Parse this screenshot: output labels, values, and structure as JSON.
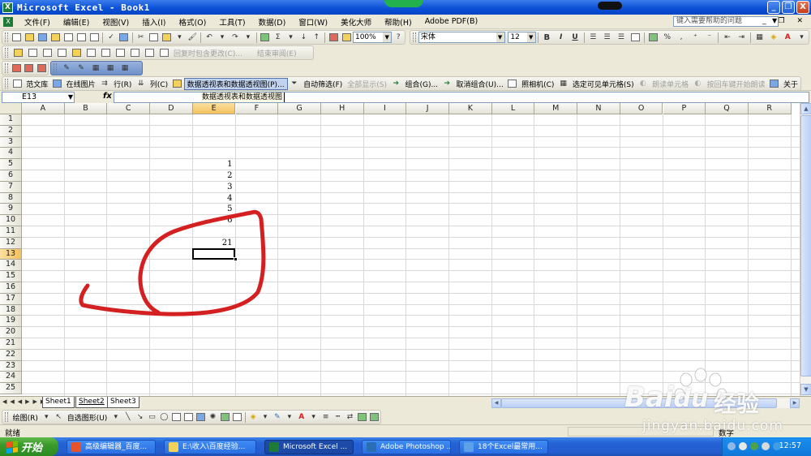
{
  "window": {
    "title": "Microsoft Excel - Book1",
    "minimize": "_",
    "restore": "❐",
    "close": "X"
  },
  "menu": {
    "items": [
      "文件(F)",
      "编辑(E)",
      "视图(V)",
      "插入(I)",
      "格式(O)",
      "工具(T)",
      "数据(D)",
      "窗口(W)",
      "美化大师",
      "帮助(H)",
      "Adobe PDF(B)"
    ],
    "help_placeholder": "键入需要帮助的问题"
  },
  "standard_toolbar": {
    "zoom": "100%"
  },
  "formatting_toolbar": {
    "font": "宋体",
    "size": "12",
    "bold": "B",
    "italic": "I",
    "underline": "U",
    "percent": "%",
    "comma": ","
  },
  "review_toolbar": {
    "reply_label": "回复时包含更改(C)...",
    "end_review": "结束审阅(E)"
  },
  "custom_toolbar": {
    "items": [
      "范文库",
      "在线图片",
      "行(R)",
      "列(C)",
      "数据透视表和数据透视图(P)...",
      "自动筛选(F)",
      "全部显示(S)",
      "组合(G)...",
      "取消组合(U)...",
      "照相机(C)",
      "选定可见单元格(S)",
      "朗读单元格",
      "按回车键开始朗读",
      "关于"
    ]
  },
  "formula_bar": {
    "name_box": "E13",
    "fx": "fx",
    "hint": "数据透视表和数据透视图"
  },
  "sheet": {
    "columns": [
      "A",
      "B",
      "C",
      "D",
      "E",
      "F",
      "G",
      "H",
      "I",
      "J",
      "K",
      "L",
      "M",
      "N",
      "O",
      "P",
      "Q",
      "R"
    ],
    "rows": [
      "1",
      "2",
      "3",
      "4",
      "5",
      "6",
      "7",
      "8",
      "9",
      "10",
      "11",
      "12",
      "13",
      "14",
      "15",
      "16",
      "17",
      "18",
      "19",
      "20",
      "21",
      "22",
      "23",
      "24",
      "25"
    ],
    "active_column": "E",
    "active_row": "13",
    "cells": [
      {
        "ref": "E5",
        "value": "1"
      },
      {
        "ref": "E6",
        "value": "2"
      },
      {
        "ref": "E7",
        "value": "3"
      },
      {
        "ref": "E8",
        "value": "4"
      },
      {
        "ref": "E9",
        "value": "5"
      },
      {
        "ref": "E10",
        "value": "6"
      },
      {
        "ref": "E12",
        "value": "21"
      }
    ]
  },
  "sheet_tabs": [
    "Sheet1",
    "Sheet2",
    "Sheet3"
  ],
  "active_sheet": "Sheet2",
  "draw_toolbar": {
    "draw_label": "绘图(R)",
    "autoshapes_label": "自选图形(U)"
  },
  "status": {
    "ready": "就绪",
    "num": "数字"
  },
  "taskbar": {
    "start": "开始",
    "buttons": [
      {
        "label": "高级编辑器_百度...",
        "icon_color": "#e8532b"
      },
      {
        "label": "E:\\收入\\百度经验...",
        "icon_color": "#f4d25a"
      },
      {
        "label": "Microsoft Excel ...",
        "icon_color": "#1e7b37"
      },
      {
        "label": "Adobe Photoshop ...",
        "icon_color": "#2a6fb5"
      },
      {
        "label": "18个Excel最常用...",
        "icon_color": "#5ba0e8"
      }
    ],
    "clock": "12:57"
  },
  "watermark": {
    "brand": "Bai",
    "brand2": "经验",
    "url": "jingyan.baidu.com"
  },
  "colors": {
    "annotation": "#d42020",
    "title_blue": "#0a4fd6",
    "taskbar_blue": "#245ed0",
    "start_green": "#3b9a2b"
  }
}
